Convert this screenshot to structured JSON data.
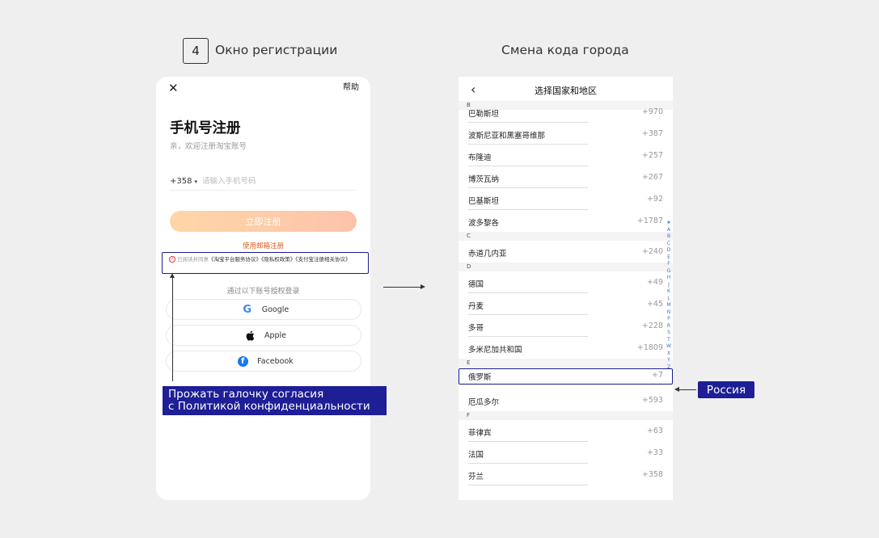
{
  "step": {
    "number": "4",
    "title": "Окно регистрации"
  },
  "right_title": "Смена кода города",
  "registration": {
    "close_icon": "✕",
    "help": "帮助",
    "title": "手机号注册",
    "subtitle": "亲，欢迎注册淘宝账号",
    "country_code": "+358",
    "caret": "▾",
    "phone_placeholder": "请输入手机号码",
    "register_button": "立即注册",
    "email_link": "使用邮箱注册",
    "agreement": {
      "prefix": "已阅读并同意",
      "doc1": "《淘宝平台服务协议》",
      "doc2": "《隐私权政策》",
      "doc3": "《支付宝注册相关协议》"
    },
    "alt_login_label": "通过以下账号授权登录",
    "logins": [
      {
        "label": "Google",
        "icon": "google-icon"
      },
      {
        "label": "Apple",
        "icon": "apple-icon"
      },
      {
        "label": "Facebook",
        "icon": "facebook-icon"
      }
    ]
  },
  "annotation_left": {
    "line1": "Прожать галочку согласия",
    "line2": "с Политикой конфиденциальности"
  },
  "country_picker": {
    "back_icon": "‹",
    "title": "选择国家和地区",
    "sections": [
      {
        "letter": "B",
        "rows": [
          {
            "name": "巴勒斯坦",
            "code": "+970"
          },
          {
            "name": "波斯尼亚和黑塞哥维那",
            "code": "+387"
          },
          {
            "name": "布隆迪",
            "code": "+257"
          },
          {
            "name": "博茨瓦纳",
            "code": "+267"
          },
          {
            "name": "巴基斯坦",
            "code": "+92"
          },
          {
            "name": "波多黎各",
            "code": "+1787"
          }
        ]
      },
      {
        "letter": "C",
        "rows": [
          {
            "name": "赤道几内亚",
            "code": "+240"
          }
        ]
      },
      {
        "letter": "D",
        "rows": [
          {
            "name": "德国",
            "code": "+49"
          },
          {
            "name": "丹麦",
            "code": "+45"
          },
          {
            "name": "多哥",
            "code": "+228"
          },
          {
            "name": "多米尼加共和国",
            "code": "+1809"
          }
        ]
      },
      {
        "letter": "E",
        "rows": [
          {
            "name": "俄罗斯",
            "code": "+7"
          },
          {
            "name": "厄瓜多尔",
            "code": "+593"
          }
        ]
      },
      {
        "letter": "F",
        "rows": [
          {
            "name": "菲律宾",
            "code": "+63"
          },
          {
            "name": "法国",
            "code": "+33"
          },
          {
            "name": "芬兰",
            "code": "+358"
          }
        ]
      }
    ],
    "alpha_index": [
      "★",
      "A",
      "B",
      "C",
      "D",
      "E",
      "F",
      "G",
      "H",
      "J",
      "K",
      "L",
      "M",
      "N",
      "P",
      "R",
      "S",
      "T",
      "W",
      "X",
      "Y",
      "Z"
    ]
  },
  "annotation_right": "Россия",
  "colors": {
    "accent_navy": "#1e1e96",
    "orange_link": "#e05a1d",
    "index_blue": "#3a6fd8"
  }
}
